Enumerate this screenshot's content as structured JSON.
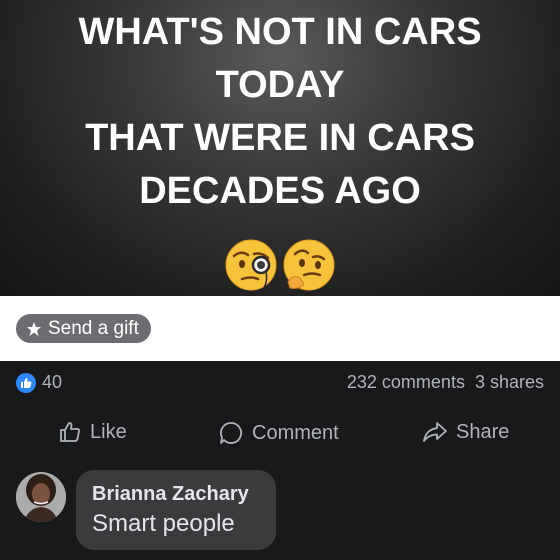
{
  "post": {
    "meme_lines": [
      "WHAT'S NOT IN CARS",
      "TODAY",
      "THAT WERE IN CARS",
      "DECADES AGO"
    ],
    "emojis": [
      "face-with-monocle",
      "thinking-face"
    ]
  },
  "gift": {
    "label": "Send a gift",
    "icon": "gift-icon"
  },
  "stats": {
    "likes": "40",
    "comments": "232 comments",
    "shares": "3 shares"
  },
  "actions": {
    "like": "Like",
    "comment": "Comment",
    "share": "Share"
  },
  "comment": {
    "author": "Brianna Zachary",
    "text": "Smart people"
  },
  "colors": {
    "background": "#18191a",
    "like_blue": "#2d88ff",
    "bubble": "#3a3b3c",
    "muted": "#b0b3b8"
  }
}
